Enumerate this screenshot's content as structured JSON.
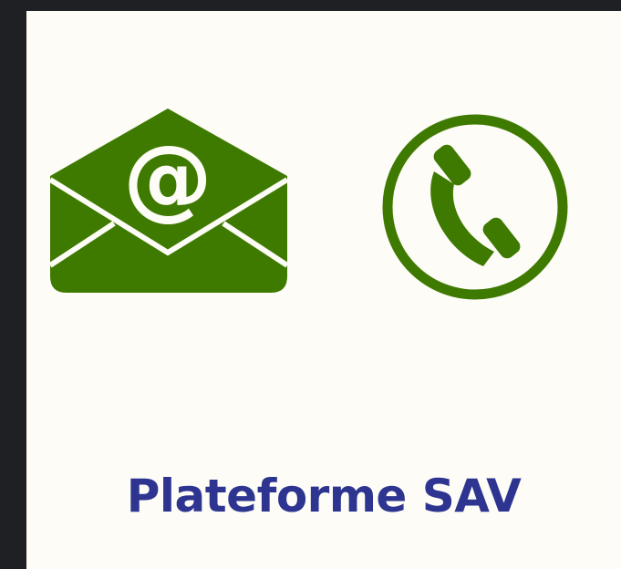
{
  "colors": {
    "page_background": "#1f2023",
    "card_background": "#fdfcf6",
    "icon_green": "#3f7a00",
    "title_blue": "#2e3591"
  },
  "icons": {
    "mail": "email-envelope-at-icon",
    "phone": "phone-circle-icon"
  },
  "content": {
    "title": "Plateforme SAV"
  }
}
